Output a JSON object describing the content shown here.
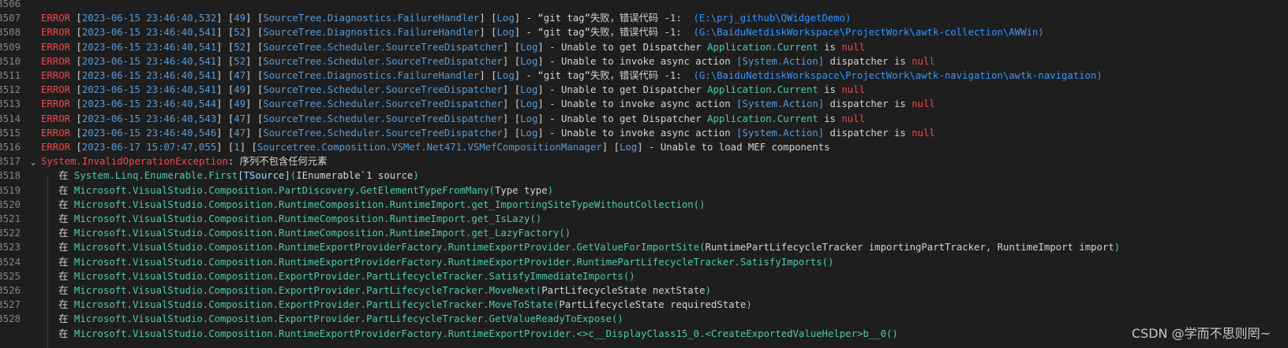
{
  "colors": {
    "background": "#1e1e1e",
    "line_number": "#858585",
    "error_red": "#f44747",
    "plain_text": "#d4d4d4",
    "namespace_blue": "#569cd6",
    "method_teal": "#4ec9b0",
    "type_param": "#9cdcfe",
    "path_blue": "#3794ff"
  },
  "editor": {
    "fold_glyph": "⌄",
    "lines": [
      {
        "n": "3506",
        "segs": []
      },
      {
        "n": "3507",
        "segs": [
          {
            "c": "err",
            "t": "ERROR"
          },
          {
            "c": "plain",
            "t": " ["
          },
          {
            "c": "blue",
            "t": "2023-06-15 23:46:40,532"
          },
          {
            "c": "plain",
            "t": "] ["
          },
          {
            "c": "blue",
            "t": "49"
          },
          {
            "c": "plain",
            "t": "] ["
          },
          {
            "c": "blue",
            "t": "SourceTree.Diagnostics.FailureHandler"
          },
          {
            "c": "plain",
            "t": "] ["
          },
          {
            "c": "blue",
            "t": "Log"
          },
          {
            "c": "plain",
            "t": "] - “git tag”失败，错误代码 -1:  "
          },
          {
            "c": "path",
            "t": "(E:\\prj_github\\QWidgetDemo)"
          }
        ]
      },
      {
        "n": "3508",
        "segs": [
          {
            "c": "err",
            "t": "ERROR"
          },
          {
            "c": "plain",
            "t": " ["
          },
          {
            "c": "blue",
            "t": "2023-06-15 23:46:40,541"
          },
          {
            "c": "plain",
            "t": "] ["
          },
          {
            "c": "blue",
            "t": "52"
          },
          {
            "c": "plain",
            "t": "] ["
          },
          {
            "c": "blue",
            "t": "SourceTree.Diagnostics.FailureHandler"
          },
          {
            "c": "plain",
            "t": "] ["
          },
          {
            "c": "blue",
            "t": "Log"
          },
          {
            "c": "plain",
            "t": "] - “git tag”失败，错误代码 -1:  "
          },
          {
            "c": "path",
            "t": "(G:\\BaiduNetdiskWorkspace\\ProjectWork\\awtk-collection\\AWWin)"
          }
        ]
      },
      {
        "n": "3509",
        "segs": [
          {
            "c": "err",
            "t": "ERROR"
          },
          {
            "c": "plain",
            "t": " ["
          },
          {
            "c": "blue",
            "t": "2023-06-15 23:46:40,541"
          },
          {
            "c": "plain",
            "t": "] ["
          },
          {
            "c": "blue",
            "t": "52"
          },
          {
            "c": "plain",
            "t": "] ["
          },
          {
            "c": "blue",
            "t": "SourceTree.Scheduler.SourceTreeDispatcher"
          },
          {
            "c": "plain",
            "t": "] ["
          },
          {
            "c": "blue",
            "t": "Log"
          },
          {
            "c": "plain",
            "t": "] - Unable to get Dispatcher "
          },
          {
            "c": "teal",
            "t": "Application.Current"
          },
          {
            "c": "plain",
            "t": " is "
          },
          {
            "c": "null",
            "t": "null"
          }
        ]
      },
      {
        "n": "3510",
        "segs": [
          {
            "c": "err",
            "t": "ERROR"
          },
          {
            "c": "plain",
            "t": " ["
          },
          {
            "c": "blue",
            "t": "2023-06-15 23:46:40,541"
          },
          {
            "c": "plain",
            "t": "] ["
          },
          {
            "c": "blue",
            "t": "52"
          },
          {
            "c": "plain",
            "t": "] ["
          },
          {
            "c": "blue",
            "t": "SourceTree.Scheduler.SourceTreeDispatcher"
          },
          {
            "c": "plain",
            "t": "] ["
          },
          {
            "c": "blue",
            "t": "Log"
          },
          {
            "c": "plain",
            "t": "] - Unable to invoke async action "
          },
          {
            "c": "blue",
            "t": "[System.Action]"
          },
          {
            "c": "plain",
            "t": " dispatcher is "
          },
          {
            "c": "null",
            "t": "null"
          }
        ]
      },
      {
        "n": "3511",
        "segs": [
          {
            "c": "err",
            "t": "ERROR"
          },
          {
            "c": "plain",
            "t": " ["
          },
          {
            "c": "blue",
            "t": "2023-06-15 23:46:40,541"
          },
          {
            "c": "plain",
            "t": "] ["
          },
          {
            "c": "blue",
            "t": "47"
          },
          {
            "c": "plain",
            "t": "] ["
          },
          {
            "c": "blue",
            "t": "SourceTree.Diagnostics.FailureHandler"
          },
          {
            "c": "plain",
            "t": "] ["
          },
          {
            "c": "blue",
            "t": "Log"
          },
          {
            "c": "plain",
            "t": "] - “git tag”失败，错误代码 -1:  "
          },
          {
            "c": "path",
            "t": "(G:\\BaiduNetdiskWorkspace\\ProjectWork\\awtk-navigation\\awtk-navigation)"
          }
        ]
      },
      {
        "n": "3512",
        "segs": [
          {
            "c": "err",
            "t": "ERROR"
          },
          {
            "c": "plain",
            "t": " ["
          },
          {
            "c": "blue",
            "t": "2023-06-15 23:46:40,541"
          },
          {
            "c": "plain",
            "t": "] ["
          },
          {
            "c": "blue",
            "t": "49"
          },
          {
            "c": "plain",
            "t": "] ["
          },
          {
            "c": "blue",
            "t": "SourceTree.Scheduler.SourceTreeDispatcher"
          },
          {
            "c": "plain",
            "t": "] ["
          },
          {
            "c": "blue",
            "t": "Log"
          },
          {
            "c": "plain",
            "t": "] - Unable to get Dispatcher "
          },
          {
            "c": "teal",
            "t": "Application.Current"
          },
          {
            "c": "plain",
            "t": " is "
          },
          {
            "c": "null",
            "t": "null"
          }
        ]
      },
      {
        "n": "3513",
        "segs": [
          {
            "c": "err",
            "t": "ERROR"
          },
          {
            "c": "plain",
            "t": " ["
          },
          {
            "c": "blue",
            "t": "2023-06-15 23:46:40,544"
          },
          {
            "c": "plain",
            "t": "] ["
          },
          {
            "c": "blue",
            "t": "49"
          },
          {
            "c": "plain",
            "t": "] ["
          },
          {
            "c": "blue",
            "t": "SourceTree.Scheduler.SourceTreeDispatcher"
          },
          {
            "c": "plain",
            "t": "] ["
          },
          {
            "c": "blue",
            "t": "Log"
          },
          {
            "c": "plain",
            "t": "] - Unable to invoke async action "
          },
          {
            "c": "blue",
            "t": "[System.Action]"
          },
          {
            "c": "plain",
            "t": " dispatcher is "
          },
          {
            "c": "null",
            "t": "null"
          }
        ]
      },
      {
        "n": "3514",
        "segs": [
          {
            "c": "err",
            "t": "ERROR"
          },
          {
            "c": "plain",
            "t": " ["
          },
          {
            "c": "blue",
            "t": "2023-06-15 23:46:40,543"
          },
          {
            "c": "plain",
            "t": "] ["
          },
          {
            "c": "blue",
            "t": "47"
          },
          {
            "c": "plain",
            "t": "] ["
          },
          {
            "c": "blue",
            "t": "SourceTree.Scheduler.SourceTreeDispatcher"
          },
          {
            "c": "plain",
            "t": "] ["
          },
          {
            "c": "blue",
            "t": "Log"
          },
          {
            "c": "plain",
            "t": "] - Unable to get Dispatcher "
          },
          {
            "c": "teal",
            "t": "Application.Current"
          },
          {
            "c": "plain",
            "t": " is "
          },
          {
            "c": "null",
            "t": "null"
          }
        ]
      },
      {
        "n": "3515",
        "segs": [
          {
            "c": "err",
            "t": "ERROR"
          },
          {
            "c": "plain",
            "t": " ["
          },
          {
            "c": "blue",
            "t": "2023-06-15 23:46:40,546"
          },
          {
            "c": "plain",
            "t": "] ["
          },
          {
            "c": "blue",
            "t": "47"
          },
          {
            "c": "plain",
            "t": "] ["
          },
          {
            "c": "blue",
            "t": "SourceTree.Scheduler.SourceTreeDispatcher"
          },
          {
            "c": "plain",
            "t": "] ["
          },
          {
            "c": "blue",
            "t": "Log"
          },
          {
            "c": "plain",
            "t": "] - Unable to invoke async action "
          },
          {
            "c": "blue",
            "t": "[System.Action]"
          },
          {
            "c": "plain",
            "t": " dispatcher is "
          },
          {
            "c": "null",
            "t": "null"
          }
        ]
      },
      {
        "n": "3516",
        "segs": [
          {
            "c": "err",
            "t": "ERROR"
          },
          {
            "c": "plain",
            "t": " ["
          },
          {
            "c": "blue",
            "t": "2023-06-17 15:07:47,055"
          },
          {
            "c": "plain",
            "t": "] ["
          },
          {
            "c": "blue",
            "t": "1"
          },
          {
            "c": "plain",
            "t": "] ["
          },
          {
            "c": "blue",
            "t": "Sourcetree.Composition.VSMef.Net471.VSMefCompositionManager"
          },
          {
            "c": "plain",
            "t": "] ["
          },
          {
            "c": "blue",
            "t": "Log"
          },
          {
            "c": "plain",
            "t": "] - Unable to load MEF components"
          }
        ]
      },
      {
        "n": "3517",
        "fold": true,
        "segs": [
          {
            "c": "exc",
            "t": "System.InvalidOperationException"
          },
          {
            "c": "plain",
            "t": ": 序列不包含任何元素"
          }
        ]
      },
      {
        "n": "3518",
        "segs": [
          {
            "c": "plain",
            "t": "   在 "
          },
          {
            "c": "teal",
            "t": "System.Linq.Enumerable.First"
          },
          {
            "c": "ptype",
            "t": "[TSource]"
          },
          {
            "c": "teal",
            "t": "("
          },
          {
            "c": "plain",
            "t": "IEnumerable`1 source"
          },
          {
            "c": "teal",
            "t": ")"
          }
        ]
      },
      {
        "n": "3519",
        "segs": [
          {
            "c": "plain",
            "t": "   在 "
          },
          {
            "c": "teal",
            "t": "Microsoft.VisualStudio.Composition.PartDiscovery.GetElementTypeFromMany("
          },
          {
            "c": "plain",
            "t": "Type type"
          },
          {
            "c": "teal",
            "t": ")"
          }
        ]
      },
      {
        "n": "3520",
        "segs": [
          {
            "c": "plain",
            "t": "   在 "
          },
          {
            "c": "teal",
            "t": "Microsoft.VisualStudio.Composition.RuntimeComposition.RuntimeImport.get_ImportingSiteTypeWithoutCollection()"
          }
        ]
      },
      {
        "n": "3521",
        "segs": [
          {
            "c": "plain",
            "t": "   在 "
          },
          {
            "c": "teal",
            "t": "Microsoft.VisualStudio.Composition.RuntimeComposition.RuntimeImport.get_IsLazy()"
          }
        ]
      },
      {
        "n": "3522",
        "segs": [
          {
            "c": "plain",
            "t": "   在 "
          },
          {
            "c": "teal",
            "t": "Microsoft.VisualStudio.Composition.RuntimeComposition.RuntimeImport.get_LazyFactory()"
          }
        ]
      },
      {
        "n": "3523",
        "segs": [
          {
            "c": "plain",
            "t": "   在 "
          },
          {
            "c": "teal",
            "t": "Microsoft.VisualStudio.Composition.RuntimeExportProviderFactory.RuntimeExportProvider.GetValueForImportSite("
          },
          {
            "c": "plain",
            "t": "RuntimePartLifecycleTracker importingPartTracker, RuntimeImport import"
          },
          {
            "c": "teal",
            "t": ")"
          }
        ]
      },
      {
        "n": "3524",
        "segs": [
          {
            "c": "plain",
            "t": "   在 "
          },
          {
            "c": "teal",
            "t": "Microsoft.VisualStudio.Composition.RuntimeExportProviderFactory.RuntimeExportProvider.RuntimePartLifecycleTracker.SatisfyImports()"
          }
        ]
      },
      {
        "n": "3525",
        "segs": [
          {
            "c": "plain",
            "t": "   在 "
          },
          {
            "c": "teal",
            "t": "Microsoft.VisualStudio.Composition.ExportProvider.PartLifecycleTracker.SatisfyImmediateImports()"
          }
        ]
      },
      {
        "n": "3526",
        "segs": [
          {
            "c": "plain",
            "t": "   在 "
          },
          {
            "c": "teal",
            "t": "Microsoft.VisualStudio.Composition.ExportProvider.PartLifecycleTracker.MoveNext("
          },
          {
            "c": "plain",
            "t": "PartLifecycleState nextState"
          },
          {
            "c": "teal",
            "t": ")"
          }
        ]
      },
      {
        "n": "3527",
        "segs": [
          {
            "c": "plain",
            "t": "   在 "
          },
          {
            "c": "teal",
            "t": "Microsoft.VisualStudio.Composition.ExportProvider.PartLifecycleTracker.MoveToState("
          },
          {
            "c": "plain",
            "t": "PartLifecycleState requiredState"
          },
          {
            "c": "teal",
            "t": ")"
          }
        ]
      },
      {
        "n": "3528",
        "segs": [
          {
            "c": "plain",
            "t": "   在 "
          },
          {
            "c": "teal",
            "t": "Microsoft.VisualStudio.Composition.ExportProvider.PartLifecycleTracker.GetValueReadyToExpose()"
          }
        ]
      },
      {
        "n": "",
        "segs": [
          {
            "c": "plain",
            "t": "   在 "
          },
          {
            "c": "teal",
            "t": "Microsoft.VisualStudio.Composition.RuntimeExportProviderFactory.RuntimeExportProvider.<>c__DisplayClass15_0.<CreateExportedValueHelper>b__0()"
          }
        ]
      }
    ]
  },
  "watermark": {
    "text": "CSDN @学而不思则罔~"
  }
}
